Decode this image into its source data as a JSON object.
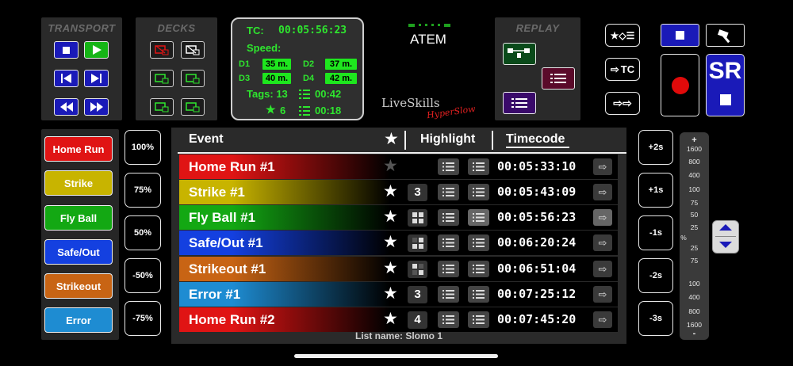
{
  "transport": {
    "title": "TRANSPORT"
  },
  "decks": {
    "title": "DECKS"
  },
  "tc": {
    "tc_label": "TC:",
    "tc_value": "00:05:56:23",
    "speed_label": "Speed:",
    "d1_label": "D1",
    "d1_value": "35 m.",
    "d2_label": "D2",
    "d2_value": "37 m.",
    "d3_label": "D3",
    "d3_value": "40 m.",
    "d4_label": "D4",
    "d4_value": "42 m.",
    "tags_label": "Tags: 13",
    "tags_time": "00:42",
    "star_count": "6",
    "star_time": "00:18"
  },
  "atem": {
    "label": "ATEM"
  },
  "logo": {
    "main": "LiveSkills",
    "sub": "HyperSlow"
  },
  "replay": {
    "title": "REPLAY"
  },
  "right_buttons": {
    "tc_label": "TC",
    "sr_label": "SR"
  },
  "event_buttons": [
    {
      "label": "Home Run",
      "color": "#e01414"
    },
    {
      "label": "Strike",
      "color": "#c8b400"
    },
    {
      "label": "Fly Ball",
      "color": "#13a813"
    },
    {
      "label": "Safe/Out",
      "color": "#1440e0"
    },
    {
      "label": "Strikeout",
      "color": "#c86414"
    },
    {
      "label": "Error",
      "color": "#1e8cd2"
    }
  ],
  "speed_buttons": [
    "100%",
    "75%",
    "50%",
    "-50%",
    "-75%"
  ],
  "table": {
    "col_event": "Event",
    "col_highlight": "Highlight",
    "col_timecode": "Timecode",
    "list_name": "List name: Slomo 1",
    "rows": [
      {
        "name": "Home Run #1",
        "count": "",
        "tc": "00:05:33:10",
        "color": "#e01414"
      },
      {
        "name": "Strike #1",
        "count": "3",
        "tc": "00:05:43:09",
        "color": "#c8b400"
      },
      {
        "name": "Fly Ball #1",
        "count": "",
        "tc": "00:05:56:23",
        "color": "#13a813"
      },
      {
        "name": "Safe/Out #1",
        "count": "",
        "tc": "00:06:20:24",
        "color": "#1440e0"
      },
      {
        "name": "Strikeout #1",
        "count": "",
        "tc": "00:06:51:04",
        "color": "#c86414"
      },
      {
        "name": "Error #1",
        "count": "3",
        "tc": "00:07:25:12",
        "color": "#1e8cd2"
      },
      {
        "name": "Home Run #2",
        "count": "4",
        "tc": "00:07:45:20",
        "color": "#e01414"
      }
    ]
  },
  "offset_buttons": [
    "+2s",
    "+1s",
    "-1s",
    "-2s",
    "-3s"
  ],
  "scale": {
    "top": "+",
    "bottom": "-",
    "mid": "%",
    "labels_top": [
      "1600",
      "800",
      "400",
      "100",
      "75",
      "50",
      "25"
    ],
    "labels_bottom": [
      "25",
      "75",
      "100",
      "400",
      "800",
      "1600"
    ]
  }
}
